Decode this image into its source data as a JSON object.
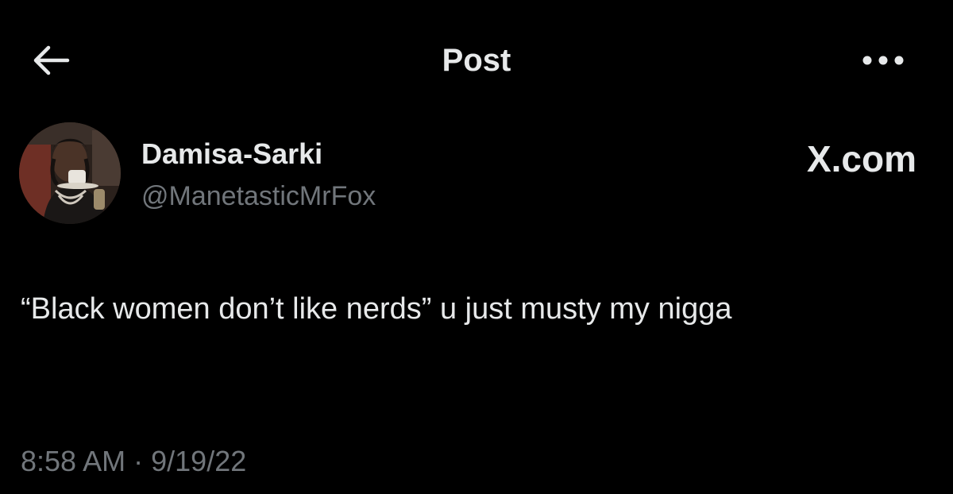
{
  "header": {
    "title": "Post",
    "back_icon": "arrow-left-icon",
    "more_icon": "more-horizontal-icon"
  },
  "author": {
    "display_name": "Damisa-Sarki",
    "handle": "@ManetasticMrFox"
  },
  "watermark": "X.com",
  "tweet": {
    "text": "“Black women don’t like nerds” u just musty my nigga",
    "time": "8:58 AM",
    "separator": "·",
    "date": "9/19/22"
  },
  "colors": {
    "background": "#000000",
    "primary_text": "#e7e9ea",
    "secondary_text": "#71767b"
  }
}
